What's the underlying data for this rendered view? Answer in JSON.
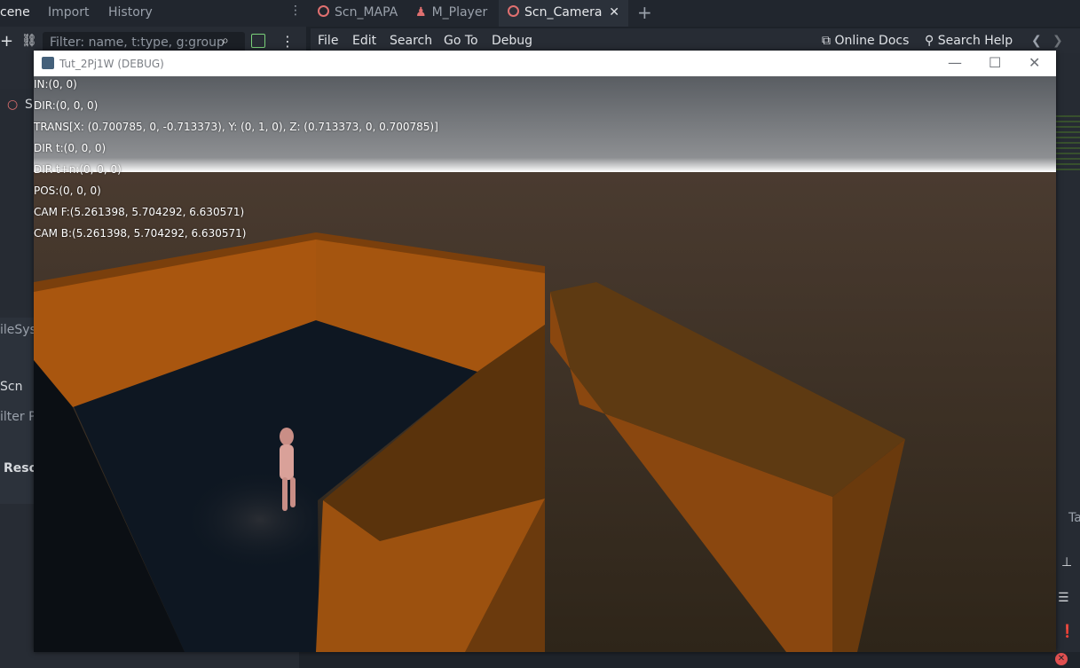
{
  "dock_tabs": [
    "cene",
    "Import",
    "History"
  ],
  "scene_filter_placeholder": "Filter: name, t:type, g:group",
  "editor_tabs": [
    {
      "label": "Scn_MAPA",
      "active": false
    },
    {
      "label": "M_Player",
      "active": false
    },
    {
      "label": "Scn_Camera",
      "active": true
    }
  ],
  "script_menu": [
    "File",
    "Edit",
    "Search",
    "Go To",
    "Debug"
  ],
  "online_docs_label": "Online Docs",
  "search_help_label": "Search Help",
  "left_dock_fragments": {
    "tree_root": "S",
    "filesystem": "ileSys",
    "scn": "Scn",
    "filter": "ilter P",
    "reso": "Reso"
  },
  "right_dock_fragment": "Ta",
  "game_window": {
    "title": "Tut_2Pj1W (DEBUG)",
    "hud": {
      "in": "IN:(0, 0)",
      "dir": "DIR:(0, 0, 0)",
      "trans": "TRANS[X: (0.700785, 0, -0.713373), Y: (0, 1, 0), Z: (0.713373, 0, 0.700785)]",
      "dir_t": "DIR t:(0, 0, 0)",
      "dir_tn": "DIR t+n:(0, 0, 0)",
      "pos": "POS:(0, 0, 0)",
      "cam_f": "CAM F:(5.261398, 5.704292, 6.630571)",
      "cam_b": "CAM B:(5.261398, 5.704292, 6.630571)"
    }
  },
  "colors": {
    "wall": "#b05a12",
    "floor": "#0e1722",
    "ground": "#3a2a1c",
    "sky_top": "#5a5e63",
    "accent_tab": "#e07070"
  }
}
